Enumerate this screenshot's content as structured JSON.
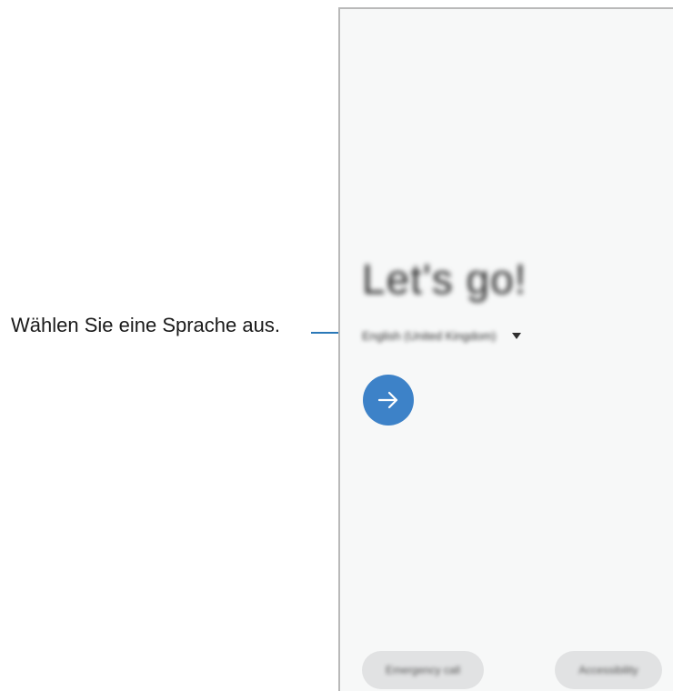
{
  "callout": {
    "text": "Wählen Sie eine Sprache aus."
  },
  "screen": {
    "headline": "Let's go!",
    "language_value": "English (United Kingdom)",
    "next_icon": "arrow-right-icon",
    "emergency_call_label": "Emergency call",
    "accessibility_label": "Accessibility"
  },
  "colors": {
    "accent": "#3d82c8",
    "callout_line": "#2a78b8",
    "screen_bg": "#f7f8f8",
    "pill_bg": "#e1e2e3"
  }
}
